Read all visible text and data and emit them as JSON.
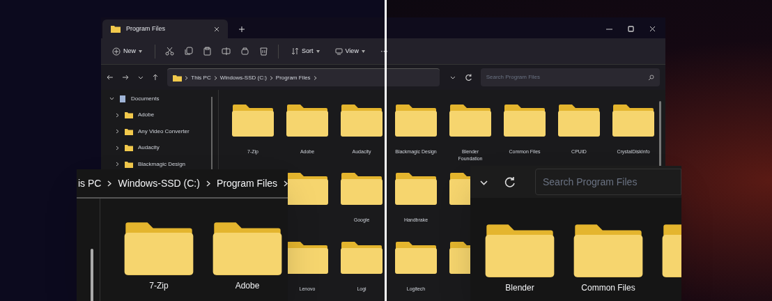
{
  "window": {
    "tab": {
      "title": "Program Files"
    }
  },
  "toolbar": {
    "new": "New",
    "sort": "Sort",
    "view": "View",
    "more": "···"
  },
  "address": {
    "crumbs": [
      "This PC",
      "Windows-SSD (C:)",
      "Program Files"
    ]
  },
  "search": {
    "placeholder": "Search Program Files"
  },
  "sidebar": {
    "items": [
      {
        "label": "Documents",
        "expanded": true,
        "children": [
          {
            "label": "Adobe",
            "expanded": false
          },
          {
            "label": "Any Video Converter",
            "expanded": false
          },
          {
            "label": "Audacity",
            "expanded": false
          },
          {
            "label": "Blackmagic Design",
            "expanded": false
          }
        ]
      }
    ]
  },
  "folders": [
    {
      "kind": "folder",
      "name": "7-Zip"
    },
    {
      "kind": "folder",
      "name": "Adobe"
    },
    {
      "kind": "folder",
      "name": "Audacity"
    },
    {
      "kind": "folder",
      "name": "Blackmagic Design"
    },
    {
      "kind": "folder",
      "name": "Blender Foundation"
    },
    {
      "kind": "folder",
      "name": "Common Files"
    },
    {
      "kind": "folder",
      "name": "CPUID"
    },
    {
      "kind": "folder",
      "name": "CrystalDiskInfo"
    },
    {
      "kind": "folder"
    },
    {
      "kind": "folder"
    },
    {
      "kind": "folder",
      "name": "Google"
    },
    {
      "kind": "folder",
      "name": "Handbrake"
    },
    {
      "kind": "folder"
    },
    {
      "kind": "folder"
    },
    {
      "kind": "folder"
    },
    {
      "kind": "folder"
    },
    {
      "kind": "folder"
    },
    {
      "kind": "folder",
      "name": "Lenovo"
    },
    {
      "kind": "folder",
      "name": "Logi"
    },
    {
      "kind": "folder",
      "name": "Logitech"
    },
    {
      "kind": "folder"
    },
    {
      "kind": "folder"
    },
    {
      "kind": "folder"
    },
    {
      "kind": "folder"
    }
  ],
  "zoom_left": {
    "crumbs": [
      "is PC",
      "Windows-SSD (C:)",
      "Program Files"
    ],
    "folders": [
      "7-Zip",
      "Adobe"
    ]
  },
  "zoom_right": {
    "search": {
      "placeholder": "Search Program Files"
    },
    "folders": [
      "Blender",
      "Common Files"
    ]
  }
}
